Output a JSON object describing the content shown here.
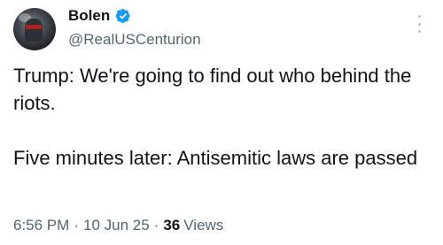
{
  "author": {
    "display_name": "Bolen",
    "handle": "@RealUSCenturion",
    "verified": true,
    "verified_color": "#1d9bf0"
  },
  "tweet": {
    "paragraphs": [
      "Trump: We're going to find out who behind the riots.",
      "Five minutes later: Antisemitic laws are passed"
    ]
  },
  "meta": {
    "time": "6:56 PM",
    "separator": "·",
    "date": "10 Jun 25",
    "views_count": "36",
    "views_label": "Views"
  },
  "icons": {
    "avatar": "profile-photo",
    "verified": "verified-badge-icon",
    "more": "more-options-icon"
  }
}
